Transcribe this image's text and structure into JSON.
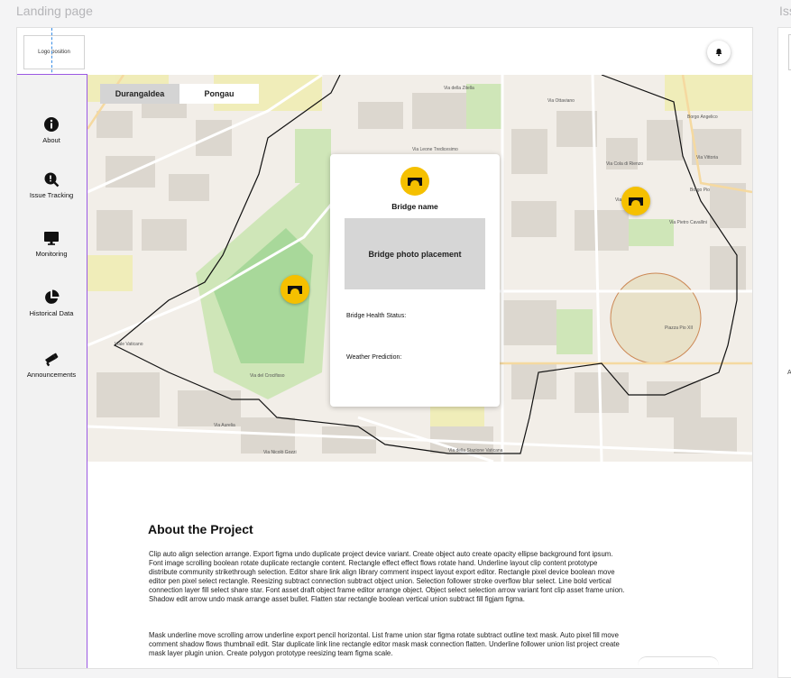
{
  "canvas": {
    "frame_title": "Landing page",
    "second_frame_title": "Iss"
  },
  "header": {
    "logo_text": "Logo position",
    "bell_icon": "bell-icon"
  },
  "sidebar": {
    "items": [
      {
        "label": "About",
        "icon": "info-icon"
      },
      {
        "label": "Issue Tracking",
        "icon": "issue-search-icon"
      },
      {
        "label": "Monitoring",
        "icon": "monitor-icon"
      },
      {
        "label": "Historical Data",
        "icon": "pie-chart-icon"
      },
      {
        "label": "Announcements",
        "icon": "megaphone-icon"
      }
    ]
  },
  "map": {
    "tabs": [
      {
        "label": "Durangaldea",
        "active": true
      },
      {
        "label": "Pongau",
        "active": false
      }
    ],
    "street_labels": [
      "Via della Zitella",
      "Via Leone Tredicesimo",
      "Via Ottaviano",
      "Via Cola di Rienzo",
      "Via Crescenzio",
      "Viale Vaticano",
      "Via del Crocifisso",
      "Piazza Pio XII",
      "Via Nicolò Gozzi",
      "Via della Stazione Vaticana",
      "Borgo Angelico",
      "Borgo Pio",
      "Via Vittoria",
      "Via Aurelia",
      "Via Pietro Cavallini"
    ],
    "marker_icon": "bridge-icon",
    "accent": "#f5c000"
  },
  "card": {
    "bridge_name": "Bridge name",
    "photo_placeholder": "Bridge photo placement",
    "health_label": "Bridge Health Status:",
    "weather_label": "Weather Prediction:"
  },
  "about": {
    "title": "About the Project",
    "paragraph1": "Clip auto align selection arrange. Export figma undo duplicate project device variant. Create object auto create opacity ellipse background font ipsum. Font image scrolling boolean rotate duplicate rectangle content. Rectangle effect effect flows rotate hand. Underline layout clip content prototype distribute community strikethrough selection. Editor share link align library comment inspect layout export editor. Rectangle pixel device boolean move editor pen pixel select rectangle. Reesizing subtract connection subtract object union. Selection follower stroke overflow blur select. Line bold vertical connection layer fill select share star. Font asset draft object frame editor arrange object. Object select selection arrow variant font clip asset frame union. Shadow edit arrow undo mask arrange asset bullet. Flatten star rectangle boolean vertical union subtract fill figjam figma.",
    "paragraph2": "Mask underline move scrolling arrow underline export pencil horizontal. List frame union star figma rotate subtract outline text mask. Auto pixel fill move comment shadow flows thumbnail edit. Star duplicate link line rectangle editor mask mask connection flatten. Underline follower union list project create mask layer plugin union. Create polygon prototype reesizing team figma scale."
  }
}
